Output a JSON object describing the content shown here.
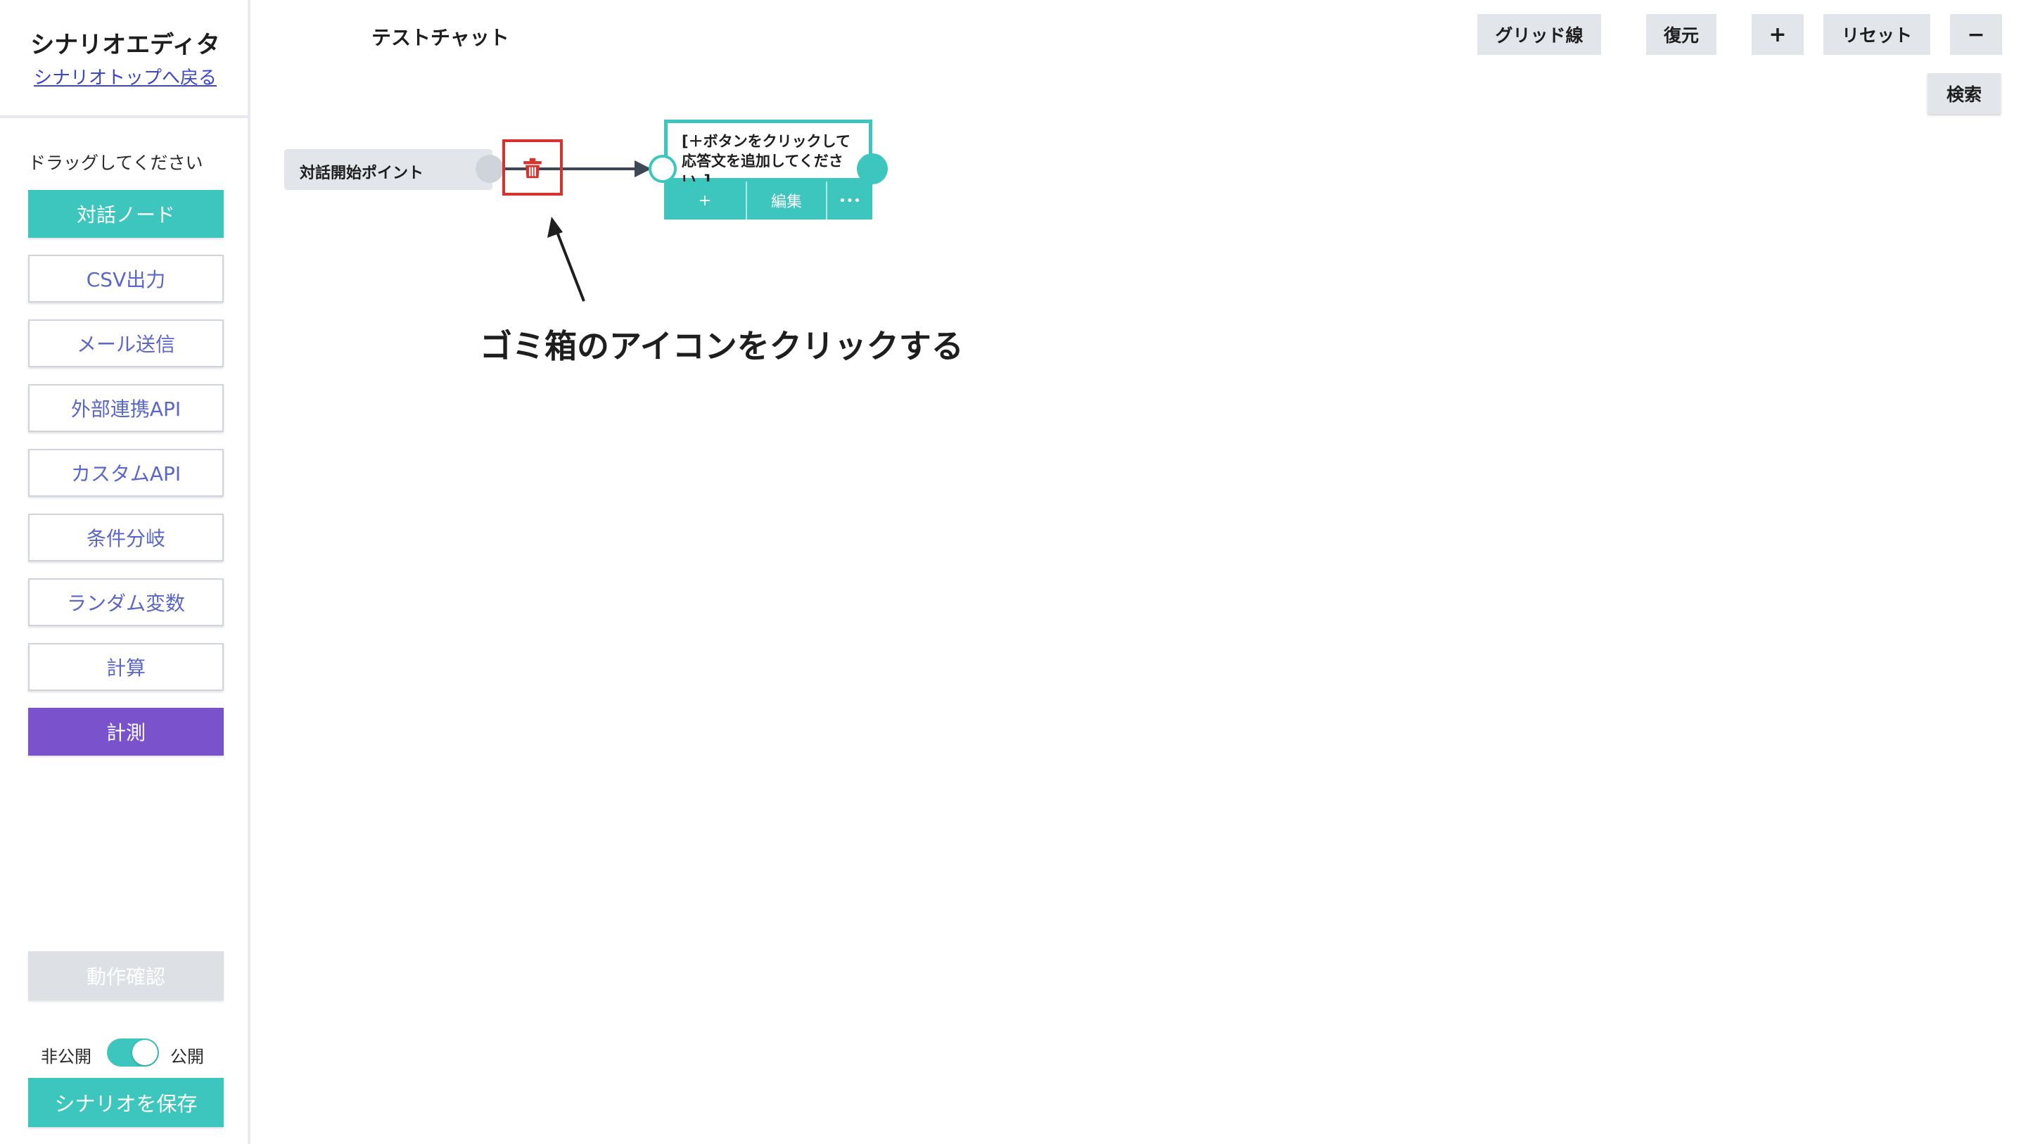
{
  "sidebar": {
    "title": "シナリオエディタ",
    "back_link": "シナリオトップへ戻る",
    "hint": "ドラッグしてください",
    "node_buttons": [
      {
        "label": "対話ノード",
        "style": "teal"
      },
      {
        "label": "CSV出力",
        "style": "outline"
      },
      {
        "label": "メール送信",
        "style": "outline"
      },
      {
        "label": "外部連携API",
        "style": "outline"
      },
      {
        "label": "カスタムAPI",
        "style": "outline"
      },
      {
        "label": "条件分岐",
        "style": "outline"
      },
      {
        "label": "ランダム変数",
        "style": "outline"
      },
      {
        "label": "計算",
        "style": "outline"
      },
      {
        "label": "計測",
        "style": "purple"
      }
    ],
    "verify_button": "動作確認",
    "visibility": {
      "off_label": "非公開",
      "on_label": "公開",
      "state": "公開"
    },
    "save_button": "シナリオを保存"
  },
  "topbar": {
    "chat_title": "テストチャット",
    "grid_button": "グリッド線",
    "restore_button": "復元",
    "zoom_in_button": "+",
    "reset_button": "リセット",
    "zoom_out_button": "−",
    "search_button": "検索"
  },
  "canvas": {
    "start_node_label": "対話開始ポイント",
    "response_node": {
      "text": "[＋ボタンをクリックして応答文を追加してください。]",
      "add_label": "+",
      "edit_label": "編集",
      "more_label": "•••"
    },
    "annotation": "ゴミ箱のアイコンをクリックする"
  },
  "colors": {
    "accent_teal": "#3cc6bd",
    "accent_purple": "#7a52cc",
    "link_blue": "#3b46c8",
    "highlight_red": "#d8322c",
    "button_gray": "#e2e5ea"
  },
  "icons": {
    "trash": "trash-icon",
    "arrow": "annotation-arrow"
  }
}
